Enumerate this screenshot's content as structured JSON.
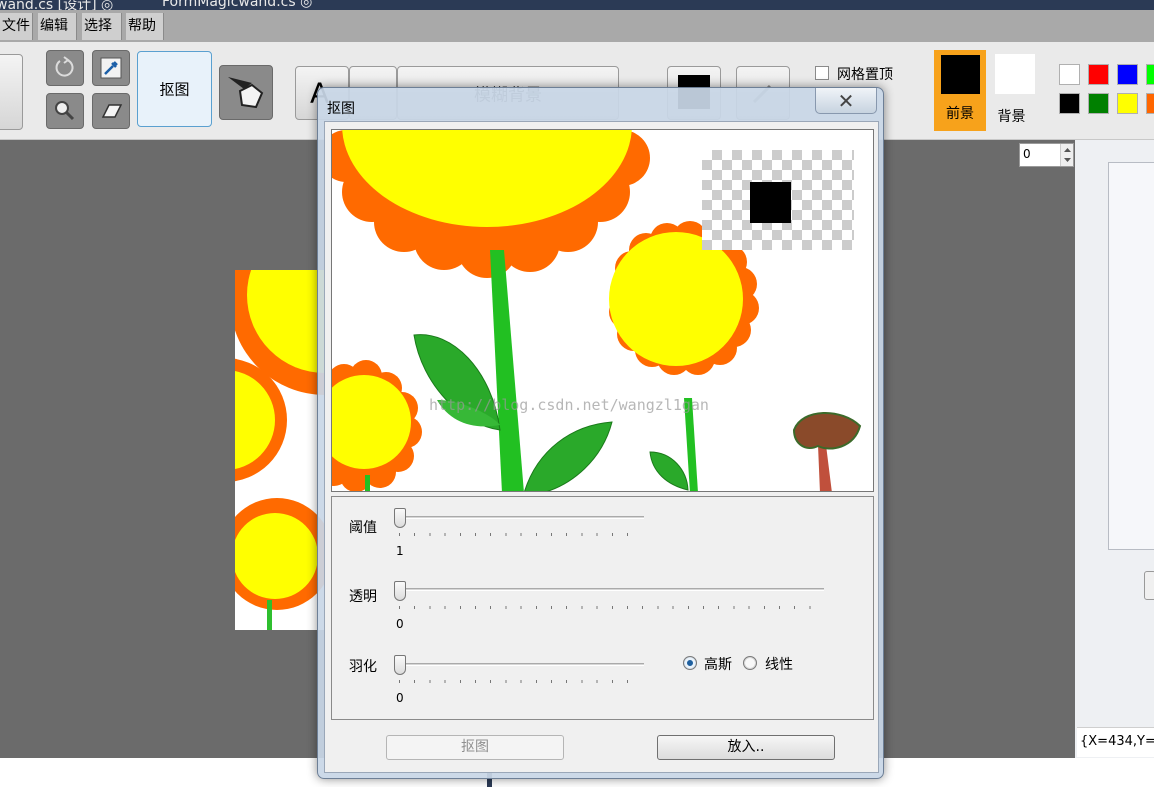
{
  "ide_tabs": {
    "left": "wand.cs [设计] ◎",
    "right": "FormMagicwand.cs ◎"
  },
  "menu": [
    "文件",
    "编辑",
    "选择",
    "帮助"
  ],
  "toolbar": {
    "cutout_label": "抠图",
    "text_tool_label": "A",
    "blur_label": "模糊背景",
    "grid_top_label": "网格置顶",
    "foreground_label": "前景",
    "background_label": "背景",
    "foreground_color": "#000000",
    "background_color": "#ffffff",
    "palette": [
      "#ffffff",
      "#ff0000",
      "#0000ff",
      "#00ff00",
      "#000000",
      "#008000",
      "#ffff00",
      "#ff6600"
    ]
  },
  "spin_value": "0",
  "coord_text": "{X=434,Y=",
  "dialog": {
    "title": "抠图",
    "close_glyph": "✕",
    "watermark": "http://blog.csdn.net/wangzl1gan",
    "threshold_label": "阈值",
    "threshold_value": "1",
    "opacity_label": "透明",
    "opacity_value": "0",
    "feather_label": "羽化",
    "feather_value": "0",
    "gauss_label": "高斯",
    "linear_label": "线性",
    "gauss_selected": true,
    "cutout_button": "抠图",
    "zoom_button": "放入.."
  }
}
